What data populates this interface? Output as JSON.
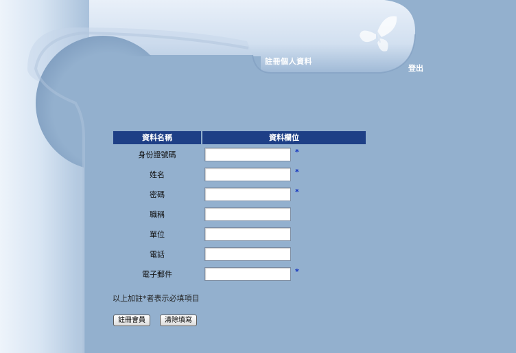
{
  "header": {
    "page_title": "註冊個人資料",
    "logout_label": "登出"
  },
  "table": {
    "col_name_header": "資料名稱",
    "col_field_header": "資料欄位",
    "rows": [
      {
        "label": "身份證號碼",
        "value": "",
        "required": "*"
      },
      {
        "label": "姓名",
        "value": "",
        "required": "*"
      },
      {
        "label": "密碼",
        "value": "",
        "required": "*"
      },
      {
        "label": "職稱",
        "value": "",
        "required": ""
      },
      {
        "label": "單位",
        "value": "",
        "required": ""
      },
      {
        "label": "電話",
        "value": "",
        "required": ""
      },
      {
        "label": "電子郵件",
        "value": "",
        "required": "*"
      }
    ]
  },
  "note": "以上加註*者表示必填項目",
  "buttons": {
    "register_label": "註冊會員",
    "reset_label": "清除填寫"
  },
  "colors": {
    "background": "#93b0ce",
    "header_bar": "#1e3f86",
    "required_mark": "#1030c0"
  },
  "icons": {
    "decoration": "butterfly-icon"
  }
}
